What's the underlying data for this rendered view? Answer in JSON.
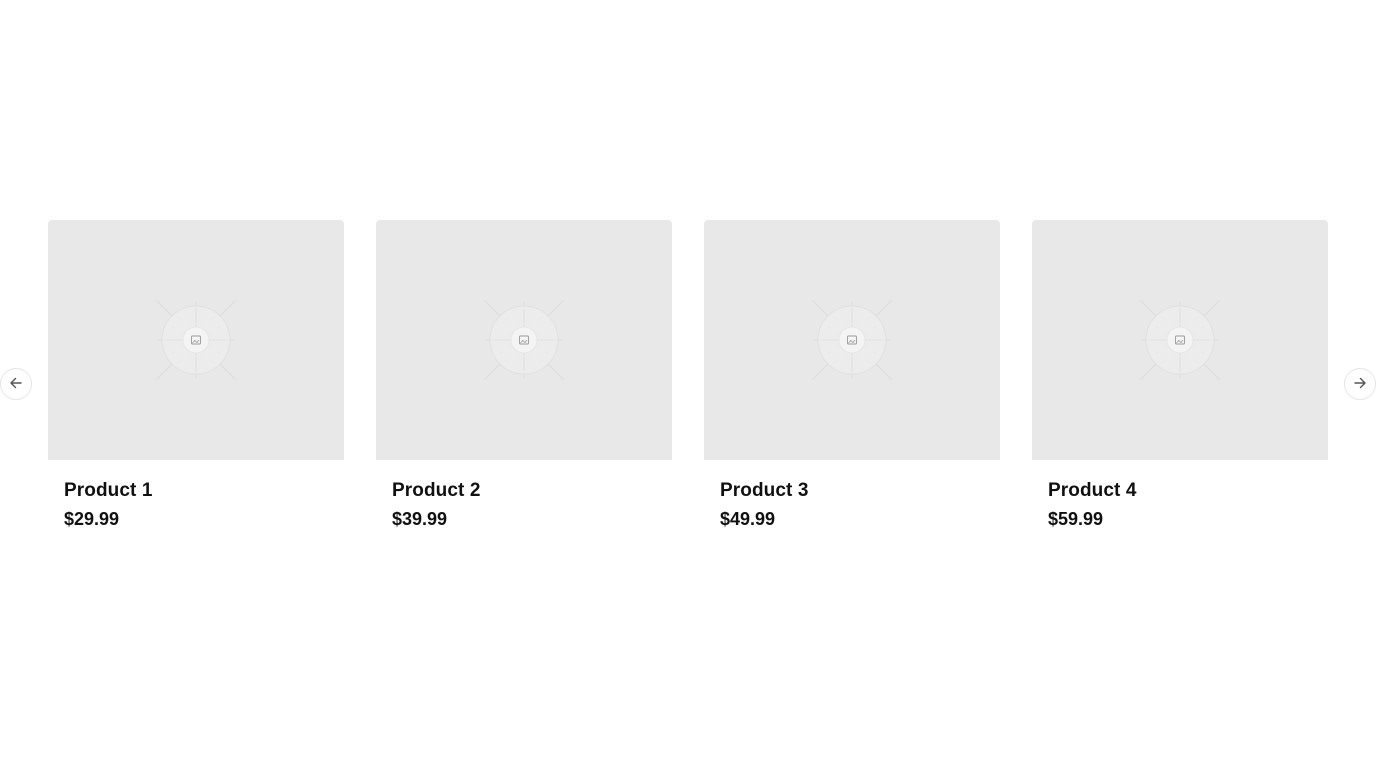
{
  "carousel": {
    "prev_icon": "arrow-left-icon",
    "next_icon": "arrow-right-icon",
    "placeholder_icon": "image-placeholder-icon",
    "colors": {
      "image_bg": "#e8e8e8",
      "text": "#111111",
      "nav_border": "#e6e6e6"
    },
    "products": [
      {
        "name": "Product 1",
        "price": "$29.99"
      },
      {
        "name": "Product 2",
        "price": "$39.99"
      },
      {
        "name": "Product 3",
        "price": "$49.99"
      },
      {
        "name": "Product 4",
        "price": "$59.99"
      }
    ]
  }
}
